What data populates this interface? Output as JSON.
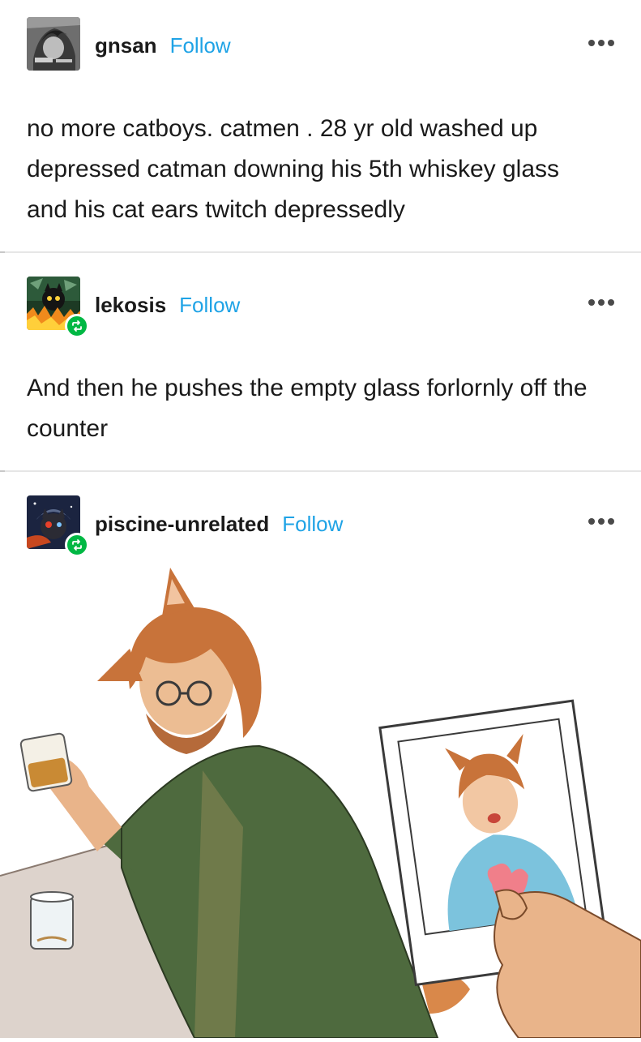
{
  "posts": [
    {
      "username": "gnsan",
      "follow_label": "Follow",
      "text": "no more catboys. catmen . 28 yr old washed up depressed catman downing his 5th whiskey glass and his cat ears twitch depressedly",
      "avatar": "manga-avatar",
      "reblog": false
    },
    {
      "username": "lekosis",
      "follow_label": "Follow",
      "text": "And then he pushes the empty glass forlornly off the counter",
      "avatar": "fire-cat-avatar",
      "reblog": true
    },
    {
      "username": "piscine-unrelated",
      "follow_label": "Follow",
      "avatar": "space-cat-avatar",
      "reblog": true
    }
  ],
  "icons": {
    "more": "more-options-icon",
    "reblog": "reblog-icon"
  },
  "colors": {
    "follow": "#1fa3e6",
    "reblog_badge": "#00b844",
    "divider": "#e6e6e6"
  }
}
